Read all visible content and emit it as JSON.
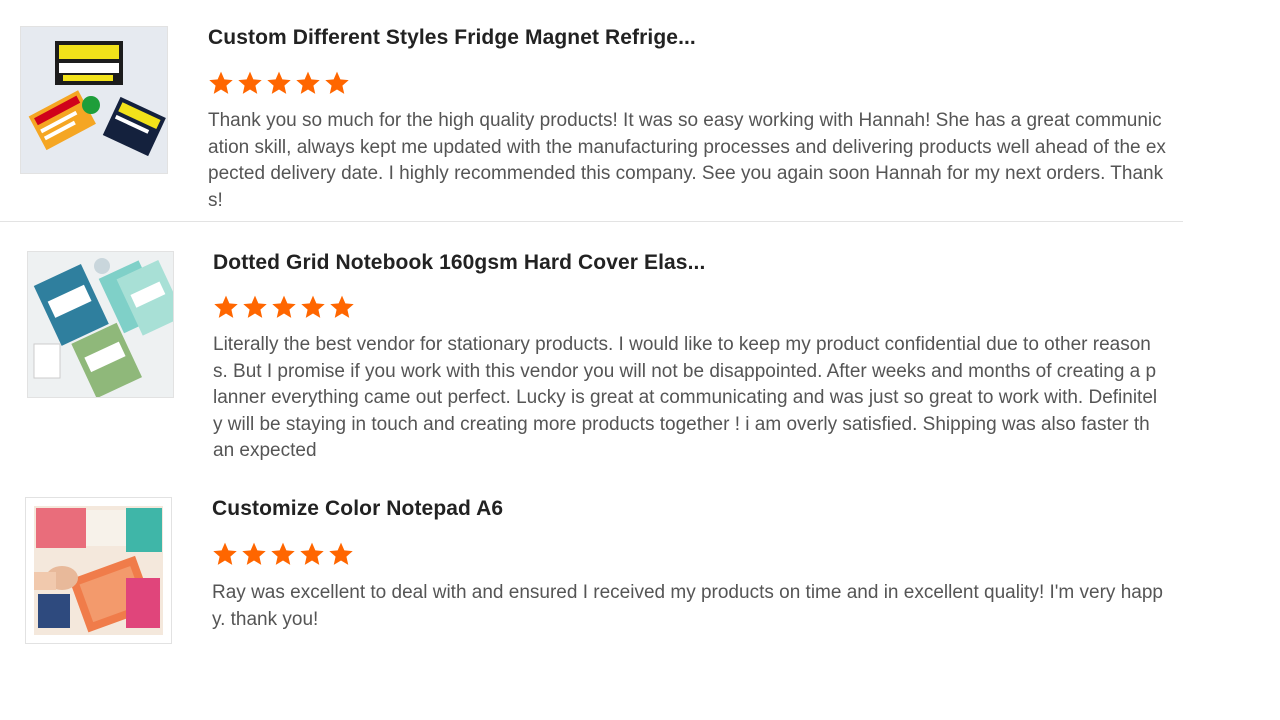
{
  "colors": {
    "star": "#ff6600",
    "title": "#222222",
    "body": "#555555",
    "divider": "#e3e3e3"
  },
  "reviews": [
    {
      "product_title": "Custom Different Styles Fridge Magnet Refrige...",
      "rating": 5,
      "thumbnail_icon": "fridge-magnet-product-image",
      "text": "Thank you so much for the high quality products! It was so easy working with Hannah! She has a great communication skill, always kept me updated with the manufacturing processes and delivering products well ahead of the expected delivery date. I highly recommended this company. See you again soon Hannah for my next orders. Thanks!"
    },
    {
      "product_title": "Dotted Grid Notebook 160gsm Hard Cover Elas...",
      "rating": 5,
      "thumbnail_icon": "notebook-product-image",
      "text": "Literally the best vendor for stationary products. I would like to keep my product confidential due to other reasons. But I promise if you work with this vendor you will not be disappointed. After weeks and months of creating a planner everything came out perfect. Lucky is great at communicating and was just so great to work with. Definitely will be staying in touch and creating more products together ! i am overly satisfied. Shipping was also faster than expected"
    },
    {
      "product_title": "Customize Color Notepad A6",
      "rating": 5,
      "thumbnail_icon": "notepad-product-image",
      "text": "Ray was excellent to deal with and ensured I received my products on time and in excellent quality! I'm very happy. thank you!"
    }
  ]
}
